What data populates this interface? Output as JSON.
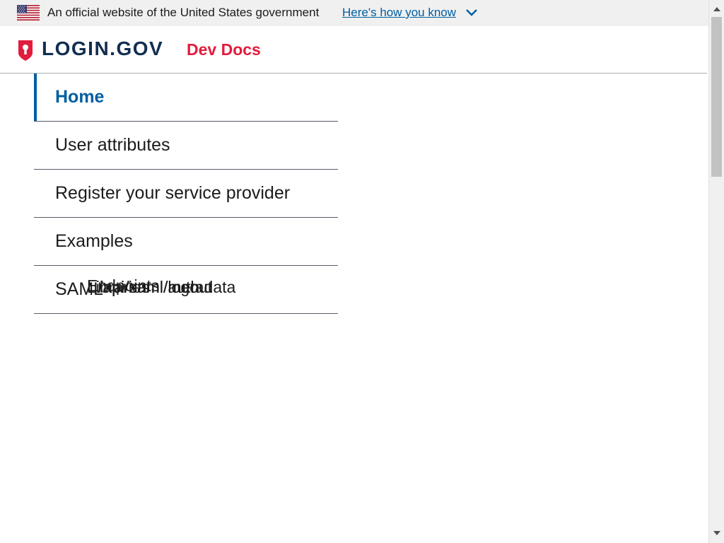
{
  "gov_banner": {
    "flag_icon": "us-flag-icon",
    "official_text": "An official website of the United States government",
    "how_you_know_link": "Here's how you know",
    "chevron_icon": "chevron-down-icon"
  },
  "header": {
    "logo_icon": "login-gov-shield-icon",
    "logo_text": "LOGIN.GOV",
    "site_name": "Dev Docs",
    "colors": {
      "logo_text": "#112e51",
      "site_name": "#e21c3d",
      "shield": "#e21c3d"
    }
  },
  "sidenav": {
    "items": [
      {
        "label": "Home",
        "current": true
      },
      {
        "label": "User attributes"
      },
      {
        "label": "Register your service provider"
      },
      {
        "label": "Examples"
      },
      {
        "label": "SAML",
        "children": [
          {
            "label": "Endpoints",
            "children": [
              {
                "label": "/api/saml/metadata"
              },
              {
                "label": "/api/saml/auth"
              },
              {
                "label": "/api/saml/logout"
              }
            ]
          },
          {
            "label": "Libraries"
          }
        ]
      }
    ],
    "colors": {
      "current": "#005ea2",
      "text": "#1b1b1b"
    }
  },
  "colors": {
    "banner_bg": "#f0f0f0",
    "link": "#005ea2"
  }
}
